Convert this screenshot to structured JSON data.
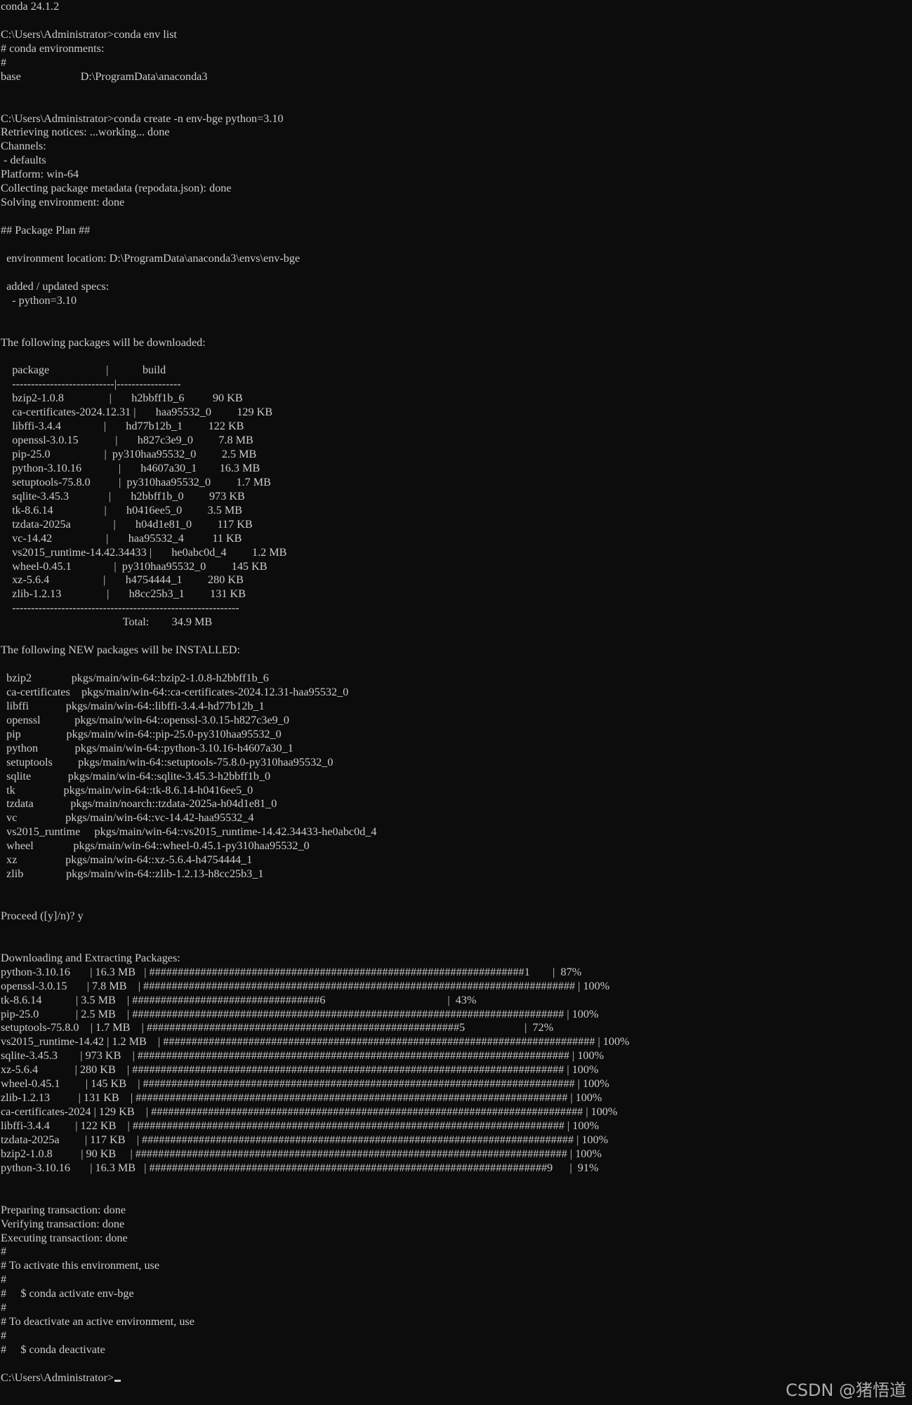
{
  "terminal": {
    "colors": {
      "background": "#0c0c0c",
      "foreground": "#cccccc"
    },
    "lines": [
      "conda 24.1.2",
      "",
      "C:\\Users\\Administrator>conda env list",
      "# conda environments:",
      "#",
      "base                     D:\\ProgramData\\anaconda3",
      "",
      "",
      "C:\\Users\\Administrator>conda create -n env-bge python=3.10",
      "Retrieving notices: ...working... done",
      "Channels:",
      " - defaults",
      "Platform: win-64",
      "Collecting package metadata (repodata.json): done",
      "Solving environment: done",
      "",
      "## Package Plan ##",
      "",
      "  environment location: D:\\ProgramData\\anaconda3\\envs\\env-bge",
      "",
      "  added / updated specs:",
      "    - python=3.10",
      "",
      "",
      "The following packages will be downloaded:",
      "",
      "    package                    |            build",
      "    ---------------------------|-----------------",
      "    bzip2-1.0.8                |       h2bbff1b_6          90 KB",
      "    ca-certificates-2024.12.31 |       haa95532_0         129 KB",
      "    libffi-3.4.4               |       hd77b12b_1         122 KB",
      "    openssl-3.0.15             |       h827c3e9_0         7.8 MB",
      "    pip-25.0                   |  py310haa95532_0         2.5 MB",
      "    python-3.10.16             |       h4607a30_1        16.3 MB",
      "    setuptools-75.8.0          |  py310haa95532_0         1.7 MB",
      "    sqlite-3.45.3              |       h2bbff1b_0         973 KB",
      "    tk-8.6.14                  |       h0416ee5_0         3.5 MB",
      "    tzdata-2025a               |       h04d1e81_0         117 KB",
      "    vc-14.42                   |       haa95532_4          11 KB",
      "    vs2015_runtime-14.42.34433 |       he0abc0d_4         1.2 MB",
      "    wheel-0.45.1               |  py310haa95532_0         145 KB",
      "    xz-5.6.4                   |       h4754444_1         280 KB",
      "    zlib-1.2.13                |       h8cc25b3_1         131 KB",
      "    ------------------------------------------------------------",
      "                                           Total:        34.9 MB",
      "",
      "The following NEW packages will be INSTALLED:",
      "",
      "  bzip2              pkgs/main/win-64::bzip2-1.0.8-h2bbff1b_6",
      "  ca-certificates    pkgs/main/win-64::ca-certificates-2024.12.31-haa95532_0",
      "  libffi             pkgs/main/win-64::libffi-3.4.4-hd77b12b_1",
      "  openssl            pkgs/main/win-64::openssl-3.0.15-h827c3e9_0",
      "  pip                pkgs/main/win-64::pip-25.0-py310haa95532_0",
      "  python             pkgs/main/win-64::python-3.10.16-h4607a30_1",
      "  setuptools         pkgs/main/win-64::setuptools-75.8.0-py310haa95532_0",
      "  sqlite             pkgs/main/win-64::sqlite-3.45.3-h2bbff1b_0",
      "  tk                 pkgs/main/win-64::tk-8.6.14-h0416ee5_0",
      "  tzdata             pkgs/main/noarch::tzdata-2025a-h04d1e81_0",
      "  vc                 pkgs/main/win-64::vc-14.42-haa95532_4",
      "  vs2015_runtime     pkgs/main/win-64::vs2015_runtime-14.42.34433-he0abc0d_4",
      "  wheel              pkgs/main/win-64::wheel-0.45.1-py310haa95532_0",
      "  xz                 pkgs/main/win-64::xz-5.6.4-h4754444_1",
      "  zlib               pkgs/main/win-64::zlib-1.2.13-h8cc25b3_1",
      "",
      "",
      "Proceed ([y]/n)? y",
      "",
      "",
      "Downloading and Extracting Packages:",
      "python-3.10.16       | 16.3 MB   | ##################################################################1        |  87%",
      "openssl-3.0.15       | 7.8 MB    | ############################################################################ | 100%",
      "tk-8.6.14            | 3.5 MB    | #################################6                                           |  43%",
      "pip-25.0             | 2.5 MB    | ############################################################################ | 100%",
      "setuptools-75.8.0    | 1.7 MB    | #######################################################5                     |  72%",
      "vs2015_runtime-14.42 | 1.2 MB    | ############################################################################ | 100%",
      "sqlite-3.45.3        | 973 KB    | ############################################################################ | 100%",
      "xz-5.6.4             | 280 KB    | ############################################################################ | 100%",
      "wheel-0.45.1         | 145 KB    | ############################################################################ | 100%",
      "zlib-1.2.13          | 131 KB    | ############################################################################ | 100%",
      "ca-certificates-2024 | 129 KB    | ############################################################################ | 100%",
      "libffi-3.4.4         | 122 KB    | ############################################################################ | 100%",
      "tzdata-2025a         | 117 KB    | ############################################################################ | 100%",
      "bzip2-1.0.8          | 90 KB     | ############################################################################ | 100%",
      "python-3.10.16       | 16.3 MB   | ######################################################################9      |  91%",
      "",
      "",
      "Preparing transaction: done",
      "Verifying transaction: done",
      "Executing transaction: done",
      "#",
      "# To activate this environment, use",
      "#",
      "#     $ conda activate env-bge",
      "#",
      "# To deactivate an active environment, use",
      "#",
      "#     $ conda deactivate",
      "",
      "C:\\Users\\Administrator>"
    ]
  },
  "watermark": "CSDN @猪悟道"
}
